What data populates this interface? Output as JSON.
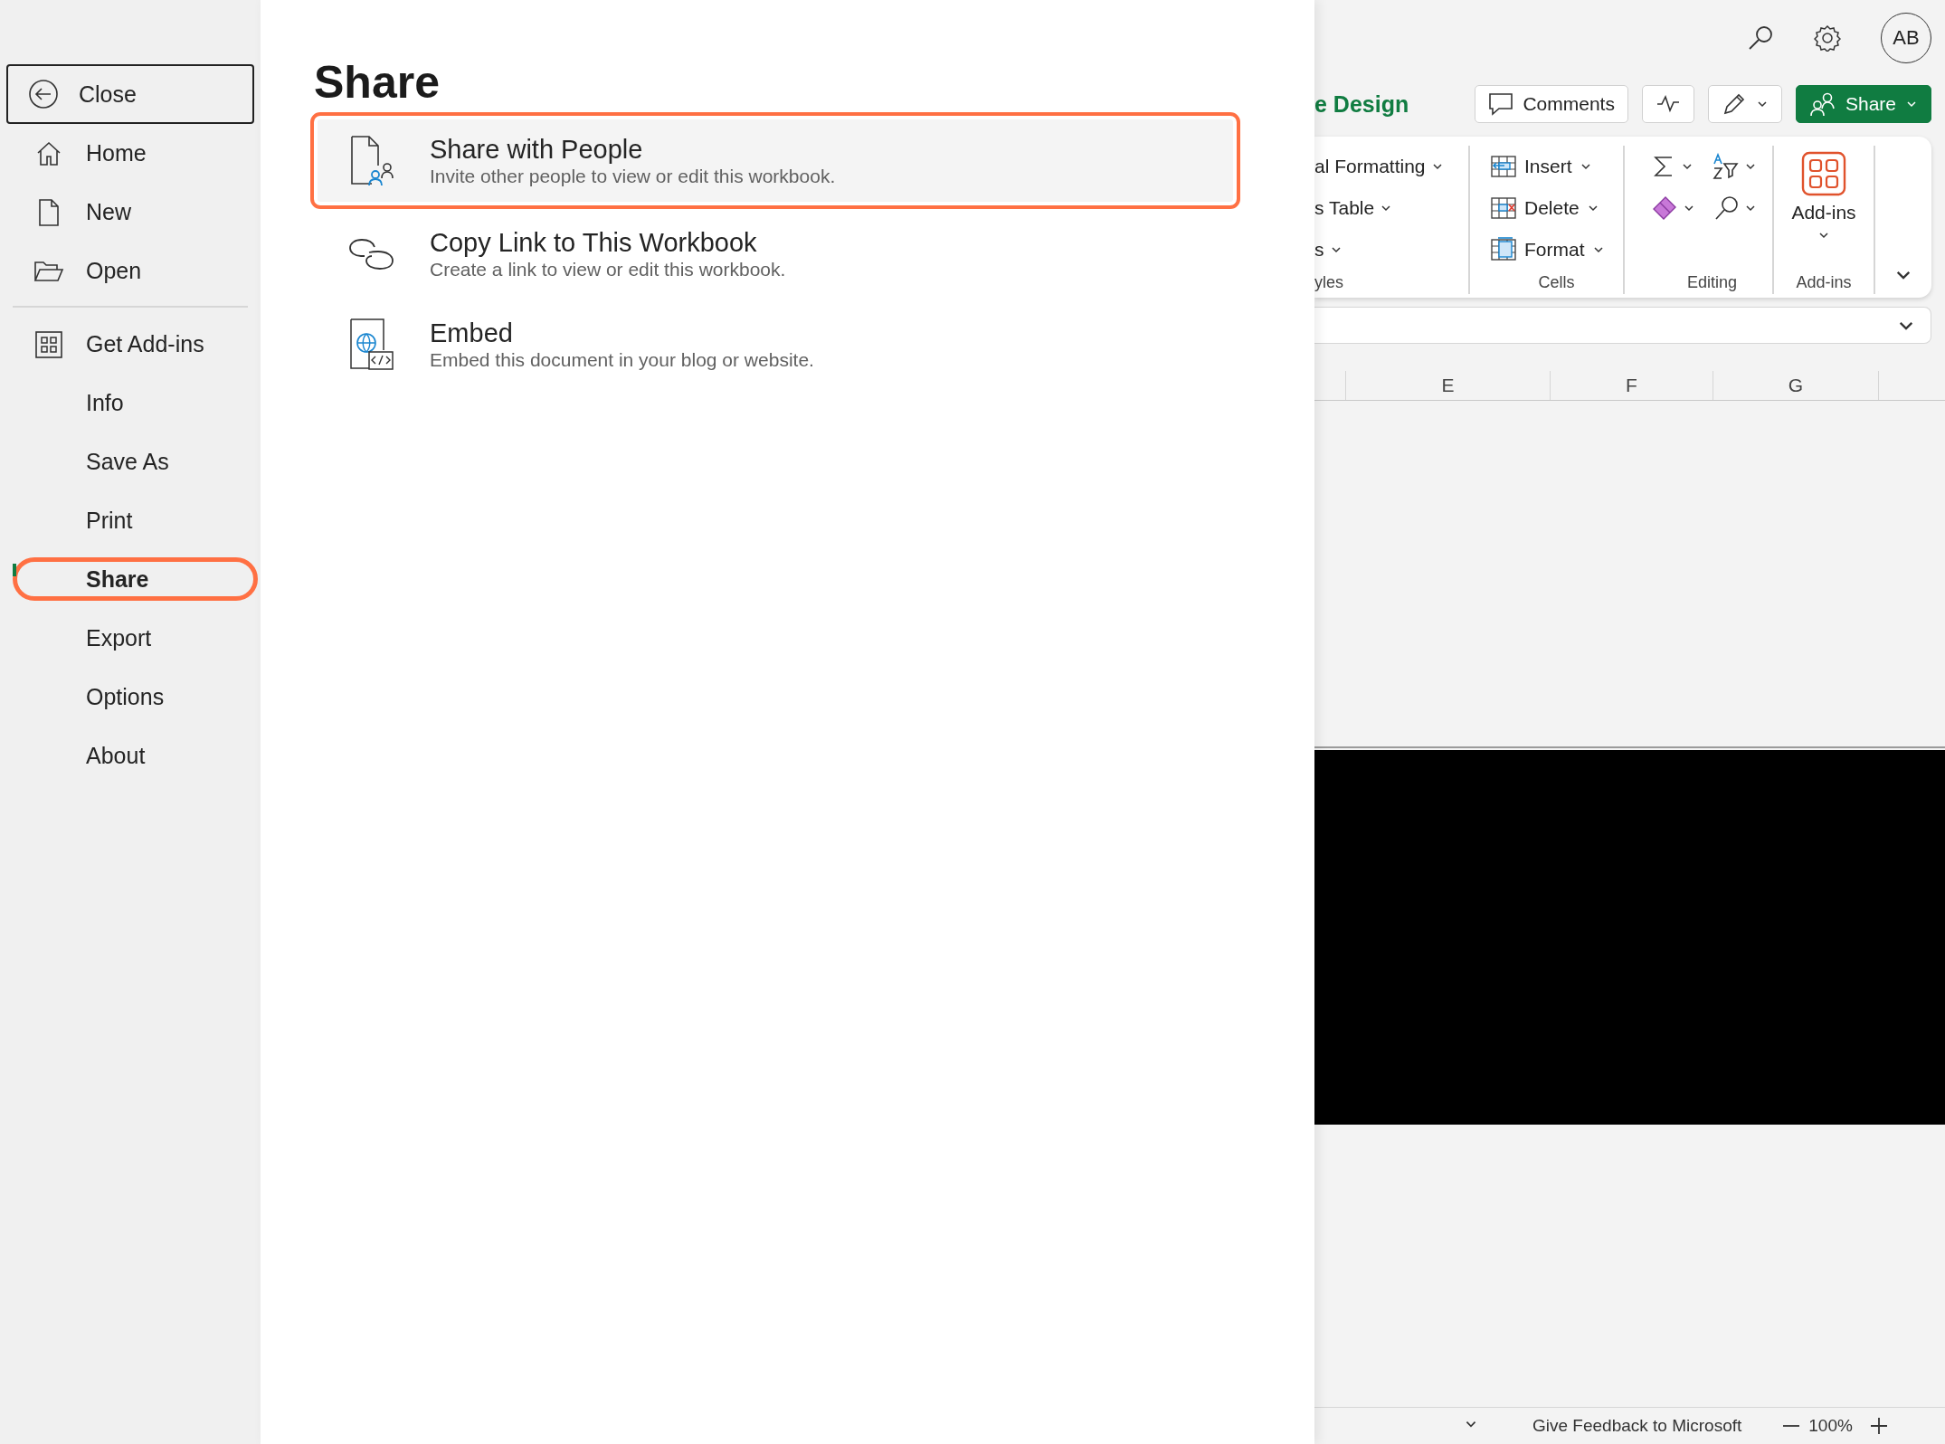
{
  "sidebar": {
    "close": "Close",
    "top_items": [
      {
        "label": "Home",
        "kind": "home",
        "selected": false,
        "highlighted": false
      },
      {
        "label": "New",
        "kind": "new",
        "selected": false,
        "highlighted": false
      },
      {
        "label": "Open",
        "kind": "open",
        "selected": false,
        "highlighted": false
      }
    ],
    "items": [
      {
        "label": "Get Add-ins",
        "kind": "addins",
        "selected": false,
        "highlighted": false
      },
      {
        "label": "Info",
        "kind": "plain",
        "selected": false,
        "highlighted": false
      },
      {
        "label": "Save As",
        "kind": "plain",
        "selected": false,
        "highlighted": false
      },
      {
        "label": "Print",
        "kind": "plain",
        "selected": false,
        "highlighted": false
      },
      {
        "label": "Share",
        "kind": "plain",
        "selected": true,
        "highlighted": true
      },
      {
        "label": "Export",
        "kind": "plain",
        "selected": false,
        "highlighted": false
      },
      {
        "label": "Options",
        "kind": "plain",
        "selected": false,
        "highlighted": false
      },
      {
        "label": "About",
        "kind": "plain",
        "selected": false,
        "highlighted": false
      }
    ]
  },
  "share_panel": {
    "title": "Share",
    "options": [
      {
        "kind": "people",
        "title": "Share with People",
        "description": "Invite other people to view or edit this workbook.",
        "highlighted": true
      },
      {
        "kind": "link",
        "title": "Copy Link to This Workbook",
        "description": "Create a link to view or edit this workbook.",
        "highlighted": false
      },
      {
        "kind": "embed",
        "title": "Embed",
        "description": "Embed this document in your blog or website.",
        "highlighted": false
      }
    ]
  },
  "workbook": {
    "avatar": "AB",
    "tab": "e Design",
    "comments_button": "Comments",
    "share_button": "Share",
    "ribbon": {
      "styles_items": [
        "al Formatting",
        "s Table",
        "s"
      ],
      "styles_label": "yles",
      "cells_items": [
        {
          "kind": "insert",
          "label": "Insert"
        },
        {
          "kind": "delete",
          "label": "Delete"
        },
        {
          "kind": "format",
          "label": "Format"
        }
      ],
      "cells_label": "Cells",
      "editing_label": "Editing",
      "addins_button": "Add-ins",
      "addins_label": "Add-ins"
    },
    "columns": [
      "E",
      "F",
      "G"
    ],
    "status_bar": {
      "feedback": "Give Feedback to Microsoft",
      "zoom": "100%"
    }
  }
}
